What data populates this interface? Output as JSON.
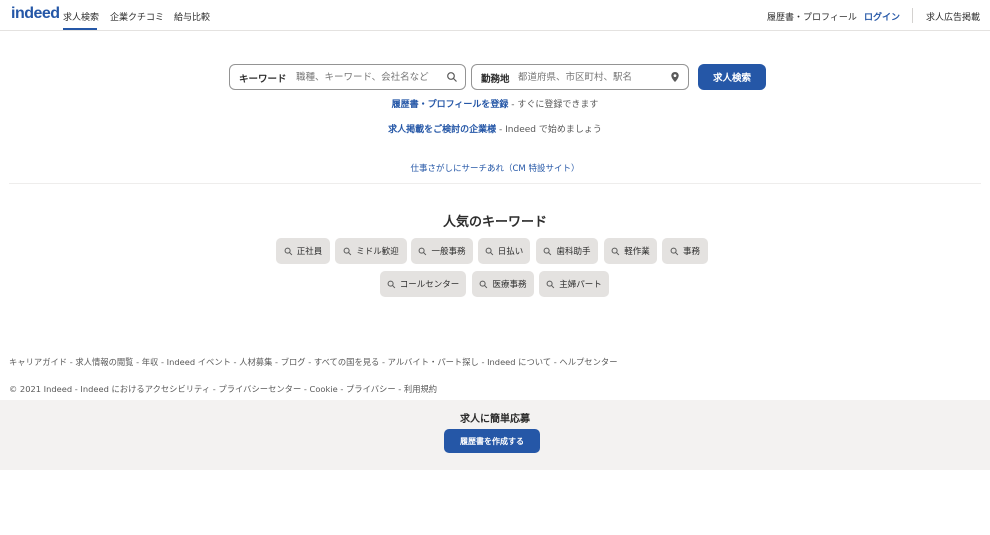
{
  "header": {
    "logo": "indeed",
    "nav": [
      "求人検索",
      "企業クチコミ",
      "給与比較"
    ],
    "right": {
      "resume": "履歴書・プロフィール",
      "login": "ログイン",
      "employers": "求人広告掲載"
    }
  },
  "search": {
    "keyword_label": "キーワード",
    "keyword_placeholder": "職種、キーワード、会社名など",
    "location_label": "勤務地",
    "location_placeholder": "都道府県、市区町村、駅名",
    "button": "求人検索"
  },
  "promo": {
    "resume_link": "履歴書・プロフィールを登録",
    "resume_rest": " - すぐに登録できます",
    "employer_link": "求人掲載をご検討の企業様",
    "employer_rest": " - Indeed で始めましょう",
    "cm_link": "仕事さがしにサーチあれ（CM 特設サイト）"
  },
  "keywords": {
    "title": "人気のキーワード",
    "row1": [
      "正社員",
      "ミドル歓迎",
      "一般事務",
      "日払い",
      "歯科助手",
      "軽作業",
      "事務"
    ],
    "row2": [
      "コールセンター",
      "医療事務",
      "主婦パート"
    ]
  },
  "footer": {
    "links": [
      "キャリアガイド",
      "求人情報の閲覧",
      "年収",
      "Indeed イベント",
      "人材募集",
      "ブログ",
      "すべての国を見る",
      "アルバイト・パート探し",
      "Indeed について",
      "ヘルプセンター"
    ],
    "copyright": "© 2021 Indeed",
    "legal": [
      "Indeed におけるアクセシビリティ",
      "プライバシーセンター",
      "Cookie",
      "プライバシー",
      "利用規約"
    ]
  },
  "apply": {
    "title": "求人に簡単応募",
    "button": "履歴書を作成する"
  },
  "colors": {
    "brand": "#2557a7",
    "chip_bg": "#e4e2e0",
    "band_bg": "#f3f2f1"
  }
}
